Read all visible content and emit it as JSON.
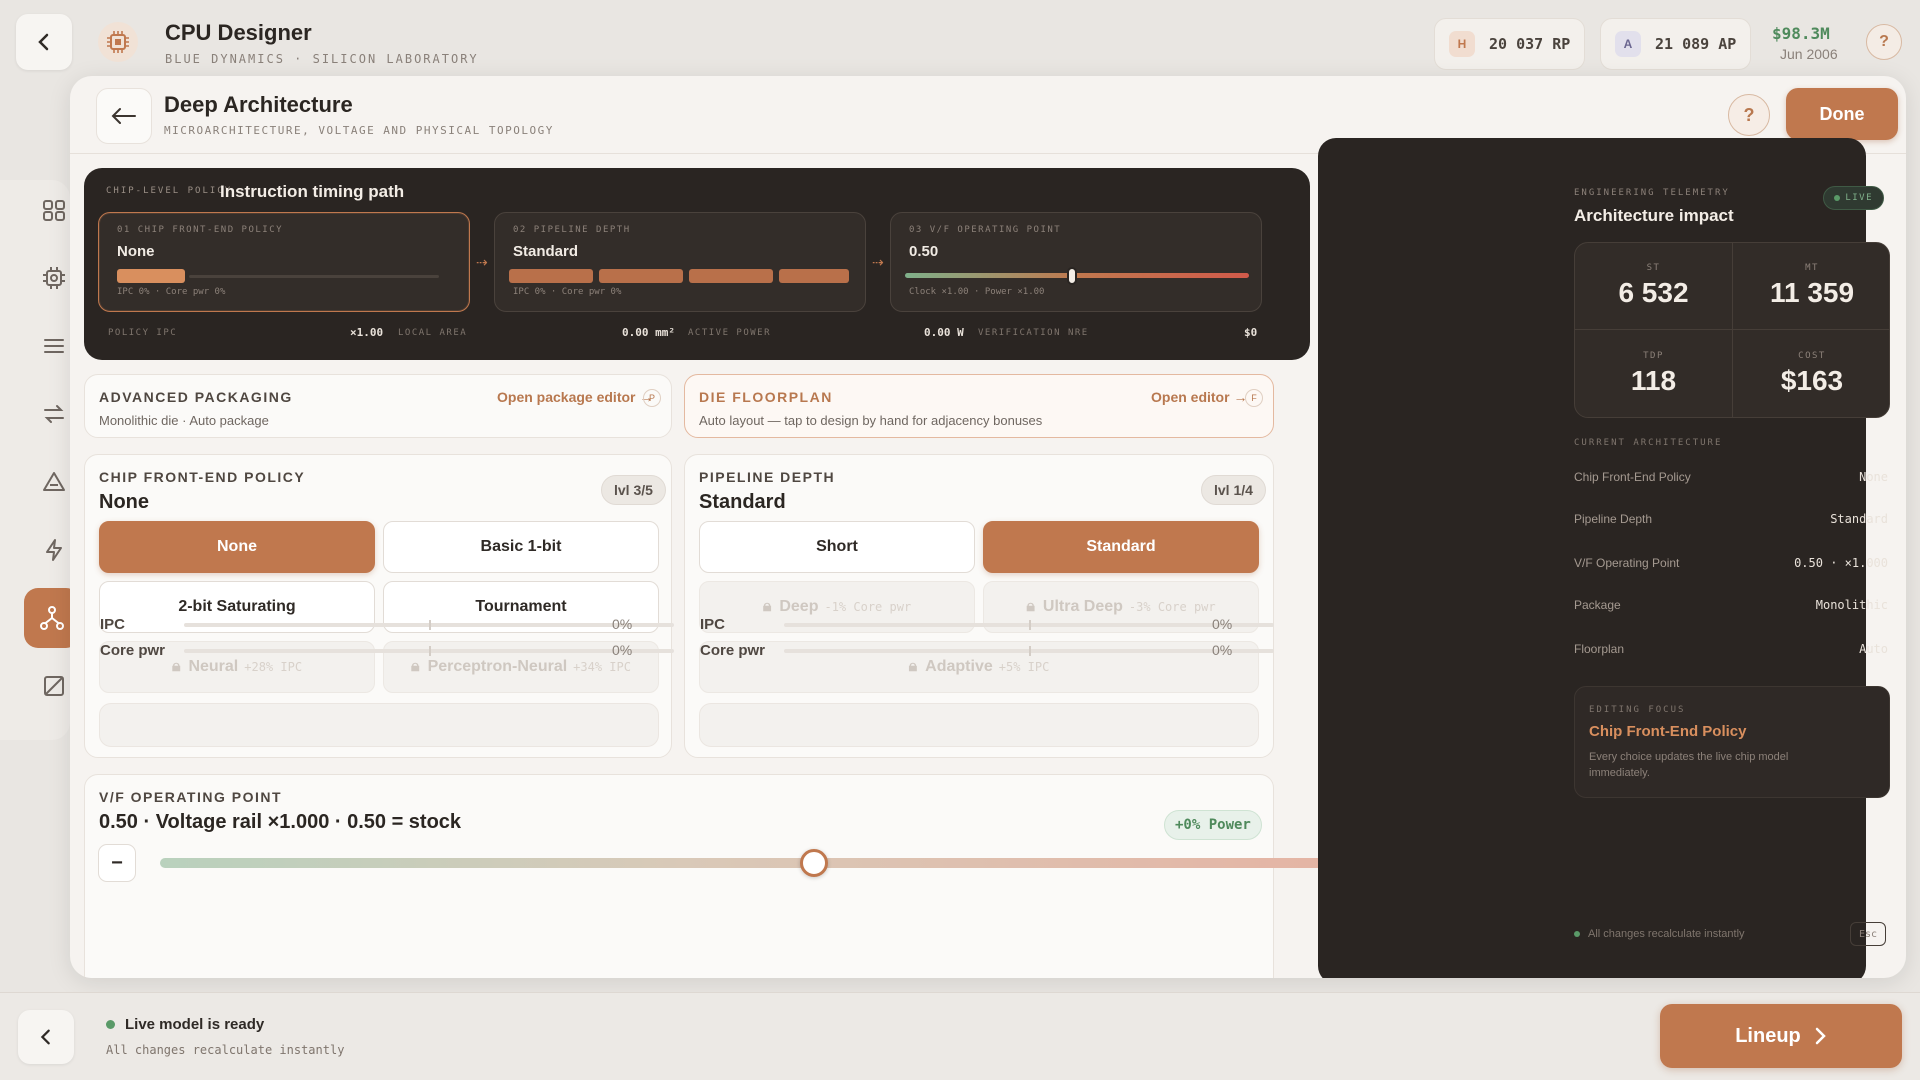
{
  "header": {
    "app_title": "CPU Designer",
    "app_subtitle": "BLUE DYNAMICS · SILICON LABORATORY",
    "research": {
      "letter": "H",
      "value": "20 037 RP"
    },
    "ability": {
      "letter": "A",
      "value": "21 089 AP"
    },
    "money": "$98.3M",
    "date": "Jun 2006",
    "help": "?"
  },
  "modal": {
    "title": "Deep Architecture",
    "subtitle": "MICROARCHITECTURE, VOLTAGE AND PHYSICAL TOPOLOGY",
    "help": "?",
    "done_label": "Done"
  },
  "timing": {
    "eyebrow": "CHIP-LEVEL POLICY",
    "title": "Instruction timing path",
    "stages": [
      {
        "name": "01  CHIP FRONT-END POLICY",
        "value": "None",
        "footer": "IPC 0% · Core pwr 0%"
      },
      {
        "name": "02  PIPELINE DEPTH",
        "value": "Standard",
        "footer": "IPC 0% · Core pwr 0%"
      },
      {
        "name": "03  V/F OPERATING POINT",
        "value": "0.50",
        "footer": "Clock ×1.00 · Power ×1.00",
        "level": 0.5
      }
    ],
    "footer": [
      {
        "label": "POLICY IPC",
        "value": "×1.00"
      },
      {
        "label": "LOCAL AREA",
        "value": "0.00 mm²"
      },
      {
        "label": "ACTIVE POWER",
        "value": "0.00 W"
      },
      {
        "label": "VERIFICATION NRE",
        "value": "$0"
      }
    ]
  },
  "packaging": {
    "title": "ADVANCED PACKAGING",
    "desc": "Monolithic die · Auto package",
    "link": "Open package editor →",
    "key": "P"
  },
  "floorplan": {
    "title": "DIE FLOORPLAN",
    "desc": "Auto layout — tap to design by hand for adjacency bonuses",
    "link": "Open editor →",
    "key": "F"
  },
  "frontend": {
    "caption": "CHIP FRONT-END POLICY",
    "selected": "None",
    "level": "lvl 3/5",
    "options": [
      {
        "label": "None",
        "state": "on"
      },
      {
        "label": "Basic 1-bit",
        "state": "off"
      },
      {
        "label": "2-bit Saturating",
        "state": "off"
      },
      {
        "label": "Tournament",
        "state": "off"
      },
      {
        "label": "Neural",
        "extra": "+28% IPC",
        "state": "locked"
      },
      {
        "label": "Perceptron-Neural",
        "extra": "+34% IPC",
        "state": "locked"
      }
    ],
    "stats": [
      {
        "label": "IPC",
        "value": "0%"
      },
      {
        "label": "Core pwr",
        "value": "0%"
      }
    ]
  },
  "pipeline": {
    "caption": "PIPELINE DEPTH",
    "selected": "Standard",
    "level": "lvl 1/4",
    "options": [
      {
        "label": "Short",
        "state": "off"
      },
      {
        "label": "Standard",
        "state": "on"
      },
      {
        "label": "Deep",
        "extra": "-1% Core pwr",
        "state": "locked"
      },
      {
        "label": "Ultra Deep",
        "extra": "-3% Core pwr",
        "state": "locked"
      },
      {
        "label": "Adaptive",
        "extra": "+5% IPC",
        "state": "locked"
      }
    ],
    "stats": [
      {
        "label": "IPC",
        "value": "0%"
      },
      {
        "label": "Core pwr",
        "value": "0%"
      }
    ]
  },
  "vf": {
    "caption": "V/F OPERATING POINT",
    "title": "0.50 · Voltage rail ×1.000 · 0.50 = stock",
    "power_chip": "+0% Power",
    "minus": "−",
    "plus": "+",
    "level": 0.5
  },
  "telemetry": {
    "eyebrow": "ENGINEERING TELEMETRY",
    "title": "Architecture impact",
    "live": "LIVE",
    "metrics": [
      {
        "label": "ST",
        "value": "6 532"
      },
      {
        "label": "MT",
        "value": "11 359"
      },
      {
        "label": "TDP",
        "value": "118"
      },
      {
        "label": "COST",
        "value": "$163"
      }
    ],
    "section": "CURRENT ARCHITECTURE",
    "rows": [
      {
        "k": "Chip Front-End Policy",
        "v": "None"
      },
      {
        "k": "Pipeline Depth",
        "v": "Standard"
      },
      {
        "k": "V/F Operating Point",
        "v": "0.50 · ×1.000"
      },
      {
        "k": "Package",
        "v": "Monolithic"
      },
      {
        "k": "Floorplan",
        "v": "Auto"
      }
    ],
    "focus_eyebrow": "EDITING FOCUS",
    "focus_title": "Chip Front-End Policy",
    "focus_desc": "Every choice updates the live chip model immediately.",
    "foot": "All changes recalculate instantly",
    "esc": "Esc"
  },
  "bottom": {
    "ready": "Live model is ready",
    "sub": "All changes recalculate instantly",
    "lineup": "Lineup"
  },
  "colors": {
    "accent": "#c0784e",
    "dark_panel": "#2a2522",
    "positive": "#4f8a5c"
  }
}
